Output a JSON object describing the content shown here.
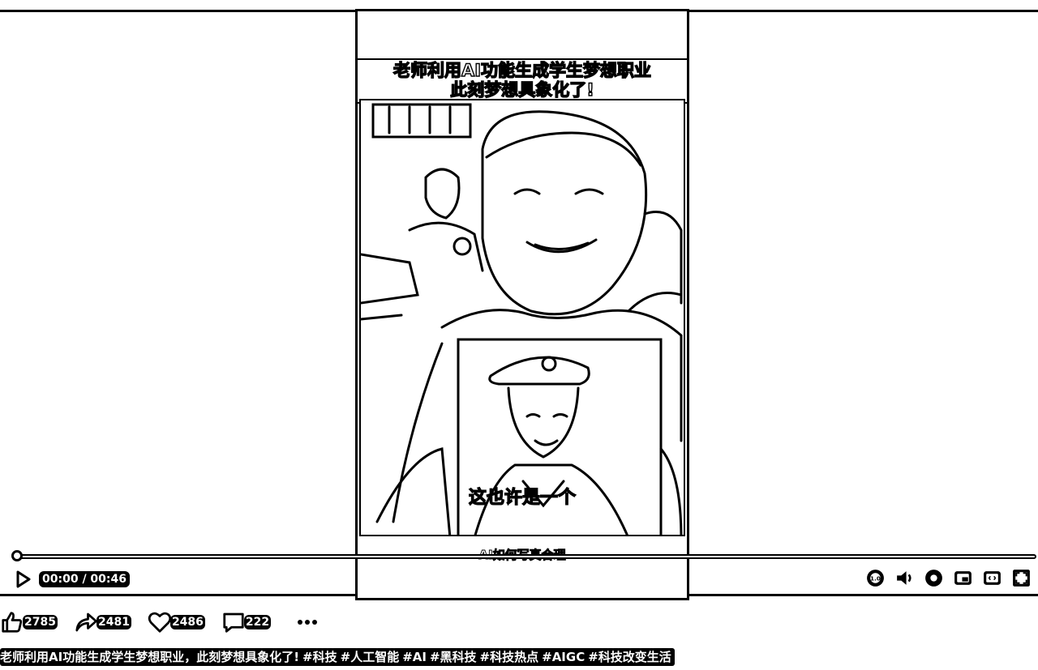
{
  "video": {
    "title_line1": "老师利用AI功能生成学生梦想职业",
    "title_line2": "此刻梦想具象化了!",
    "subtitle": "这也许是一个",
    "bottom_caption": "AI如何写真合理",
    "progress": 0.0
  },
  "controls": {
    "time_display": "00:00 / 00:46",
    "play_icon": "play-icon",
    "speed_icon": "playback-speed-icon",
    "volume_icon": "volume-icon",
    "settings_icon": "gear-icon",
    "pip_icon": "picture-in-picture-icon",
    "webfullscreen_icon": "web-fullscreen-icon",
    "fullscreen_icon": "fullscreen-icon"
  },
  "stats": {
    "likes": "2785",
    "shares": "2481",
    "favorites": "2486",
    "comments": "222"
  },
  "description": {
    "text": "老师利用AI功能生成学生梦想职业，此刻梦想具象化了!",
    "tags": [
      "#科技",
      "#人工智能",
      "#AI",
      "#黑科技",
      "#科技热点",
      "#AIGC",
      "#科技改变生活"
    ]
  }
}
